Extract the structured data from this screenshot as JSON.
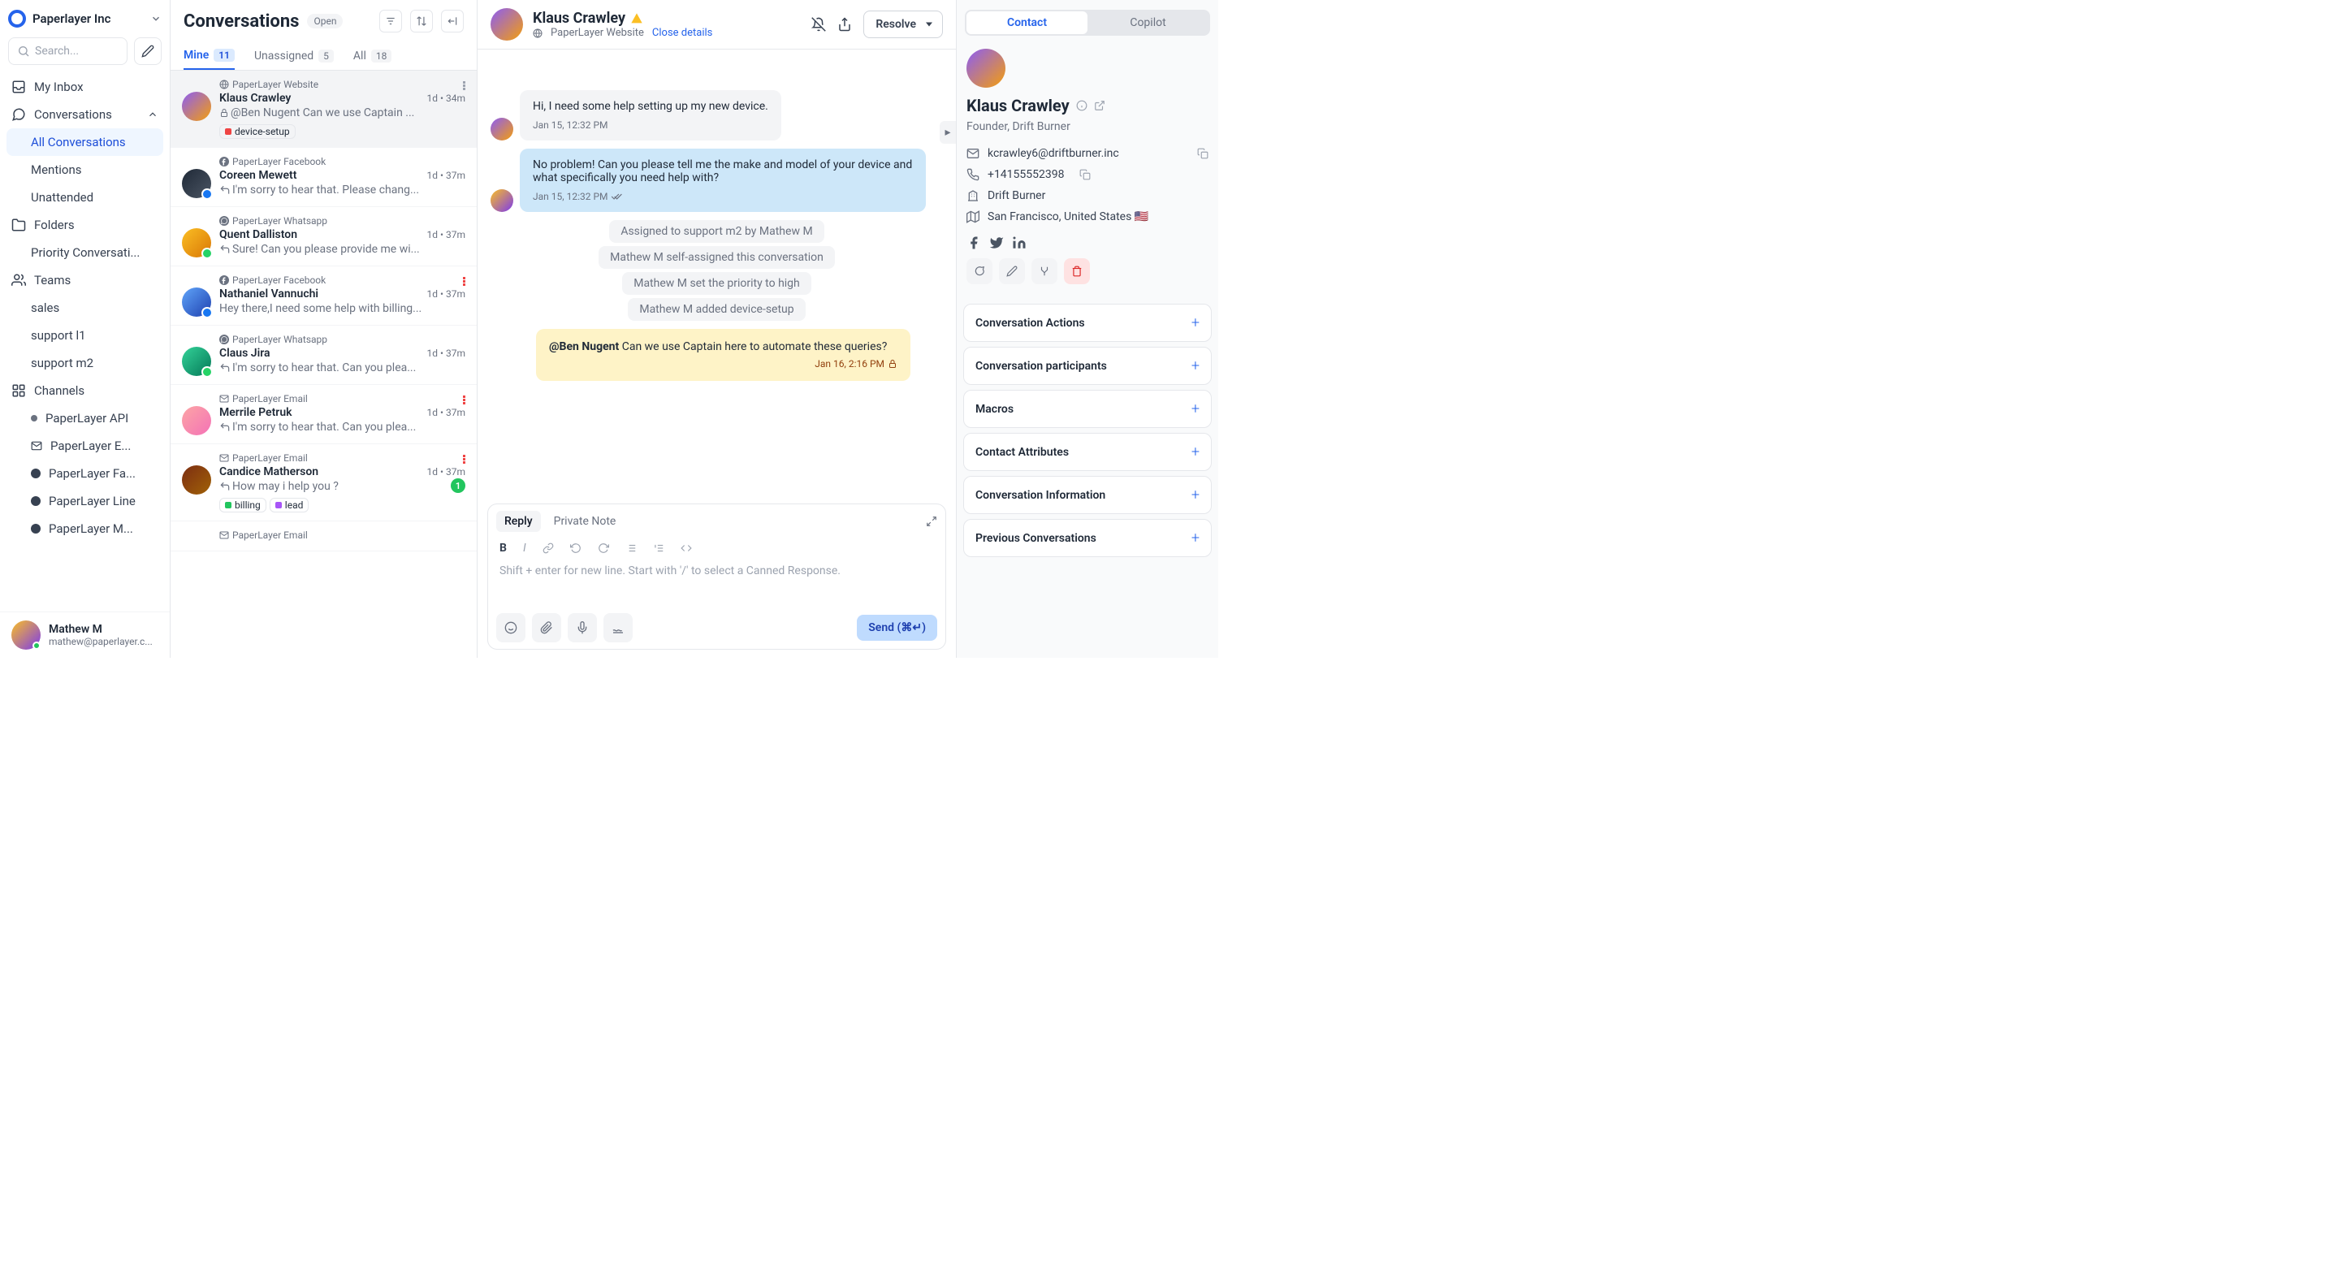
{
  "org": {
    "name": "Paperlayer Inc"
  },
  "search": {
    "placeholder": "Search..."
  },
  "nav": {
    "inbox": "My Inbox",
    "conversations": "Conversations",
    "all_conv": "All Conversations",
    "mentions": "Mentions",
    "unattended": "Unattended",
    "folders": "Folders",
    "priority": "Priority Conversati...",
    "teams": "Teams",
    "sales": "sales",
    "support1": "support l1",
    "support2": "support m2",
    "channels": "Channels",
    "ch_api": "PaperLayer API",
    "ch_email": "PaperLayer E...",
    "ch_fb": "PaperLayer Fa...",
    "ch_line": "PaperLayer Line",
    "ch_m": "PaperLayer M..."
  },
  "user": {
    "name": "Mathew M",
    "email": "mathew@paperlayer.c..."
  },
  "convHeader": {
    "title": "Conversations",
    "status": "Open"
  },
  "tabs": {
    "mine": {
      "label": "Mine",
      "count": "11"
    },
    "unassigned": {
      "label": "Unassigned",
      "count": "5"
    },
    "all": {
      "label": "All",
      "count": "18"
    }
  },
  "conversations": [
    {
      "source": "PaperLayer Website",
      "name": "Klaus Crawley",
      "time": "1d • 34m",
      "preview": "@Ben Nugent Can we use Captain ...",
      "tag": "device-setup",
      "tagColor": "#ef4444",
      "selected": true,
      "hasLock": true
    },
    {
      "source": "PaperLayer Facebook",
      "name": "Coreen Mewett",
      "time": "1d • 37m",
      "preview": "I'm sorry to hear that. Please chang...",
      "srcIcon": "fb",
      "badgeColor": "#1877f2",
      "reply": true
    },
    {
      "source": "PaperLayer Whatsapp",
      "name": "Quent Dalliston",
      "time": "1d • 37m",
      "preview": "Sure! Can you please provide me wi...",
      "srcIcon": "wa",
      "badgeColor": "#25d366",
      "reply": true
    },
    {
      "source": "PaperLayer Facebook",
      "name": "Nathaniel Vannuchi",
      "time": "1d • 37m",
      "preview": "Hey there,I need some help with billing...",
      "srcIcon": "fb",
      "badgeColor": "#1877f2",
      "priority": true
    },
    {
      "source": "PaperLayer Whatsapp",
      "name": "Claus Jira",
      "time": "1d • 37m",
      "preview": "I'm sorry to hear that. Can you plea...",
      "srcIcon": "wa",
      "badgeColor": "#25d366",
      "reply": true
    },
    {
      "source": "PaperLayer Email",
      "name": "Merrile Petruk",
      "time": "1d • 37m",
      "preview": "I'm sorry to hear that. Can you plea...",
      "srcIcon": "email",
      "reply": true,
      "priority": true
    },
    {
      "source": "PaperLayer Email",
      "name": "Candice Matherson",
      "time": "1d • 37m",
      "preview": "How may i help you ?",
      "srcIcon": "email",
      "reply": true,
      "priority": true,
      "tags": [
        {
          "label": "billing",
          "color": "#22c55e"
        },
        {
          "label": "lead",
          "color": "#a855f7"
        }
      ],
      "unread": "1"
    },
    {
      "source": "PaperLayer Email",
      "name": "",
      "time": "",
      "preview": "",
      "srcIcon": "email"
    }
  ],
  "chat": {
    "name": "Klaus Crawley",
    "source": "PaperLayer Website",
    "close": "Close details",
    "resolve": "Resolve",
    "messages": {
      "m1": {
        "text": "Hi, I need some help setting up my new device.",
        "ts": "Jan 15, 12:32 PM"
      },
      "m2": {
        "text": "No problem! Can you please tell me the make and model of your device and what specifically you need help with?",
        "ts": "Jan 15, 12:32 PM"
      }
    },
    "system": [
      "Assigned to support m2 by Mathew M",
      "Mathew M self-assigned this conversation",
      "Mathew M set the priority to high",
      "Mathew M added device-setup"
    ],
    "note": {
      "mention": "@Ben Nugent",
      "text": " Can we use Captain here to automate these queries?",
      "ts": "Jan 16, 2:16 PM"
    }
  },
  "composer": {
    "reply": "Reply",
    "private": "Private Note",
    "placeholder": "Shift + enter for new line. Start with '/' to select a Canned Response.",
    "send": "Send (⌘↵)"
  },
  "details": {
    "contact": "Contact",
    "copilot": "Copilot",
    "name": "Klaus Crawley",
    "role": "Founder, Drift Burner",
    "email": "kcrawley6@driftburner.inc",
    "phone": "+14155552398",
    "company": "Drift Burner",
    "location": "San Francisco, United States 🇺🇸",
    "accordions": [
      "Conversation Actions",
      "Conversation participants",
      "Macros",
      "Contact Attributes",
      "Conversation Information",
      "Previous Conversations"
    ]
  }
}
